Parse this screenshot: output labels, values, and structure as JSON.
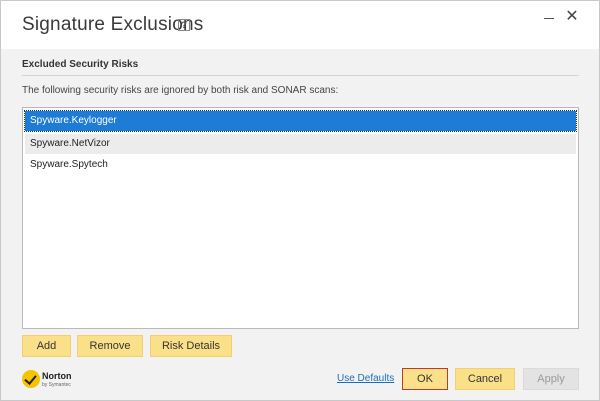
{
  "window": {
    "title": "Signature Exclusions",
    "help_glyph": "?",
    "close_glyph": "✕"
  },
  "section": {
    "title": "Excluded Security Risks",
    "description": "The following security risks are ignored by both risk and SONAR scans:"
  },
  "list": {
    "items": [
      {
        "label": "Spyware.Keylogger",
        "selected": true
      },
      {
        "label": "Spyware.NetVizor",
        "selected": false
      },
      {
        "label": "Spyware.Spytech",
        "selected": false
      }
    ]
  },
  "actions": {
    "add_label": "Add",
    "remove_label": "Remove",
    "risk_details_label": "Risk Details"
  },
  "footer": {
    "brand": "Norton",
    "brand_sub": "by Symantec",
    "use_defaults_label": "Use Defaults",
    "ok_label": "OK",
    "cancel_label": "Cancel",
    "apply_label": "Apply",
    "apply_enabled": false
  },
  "colors": {
    "accent_button": "#fbe08a",
    "selection": "#1e7bd6",
    "link": "#1a6fc0"
  }
}
